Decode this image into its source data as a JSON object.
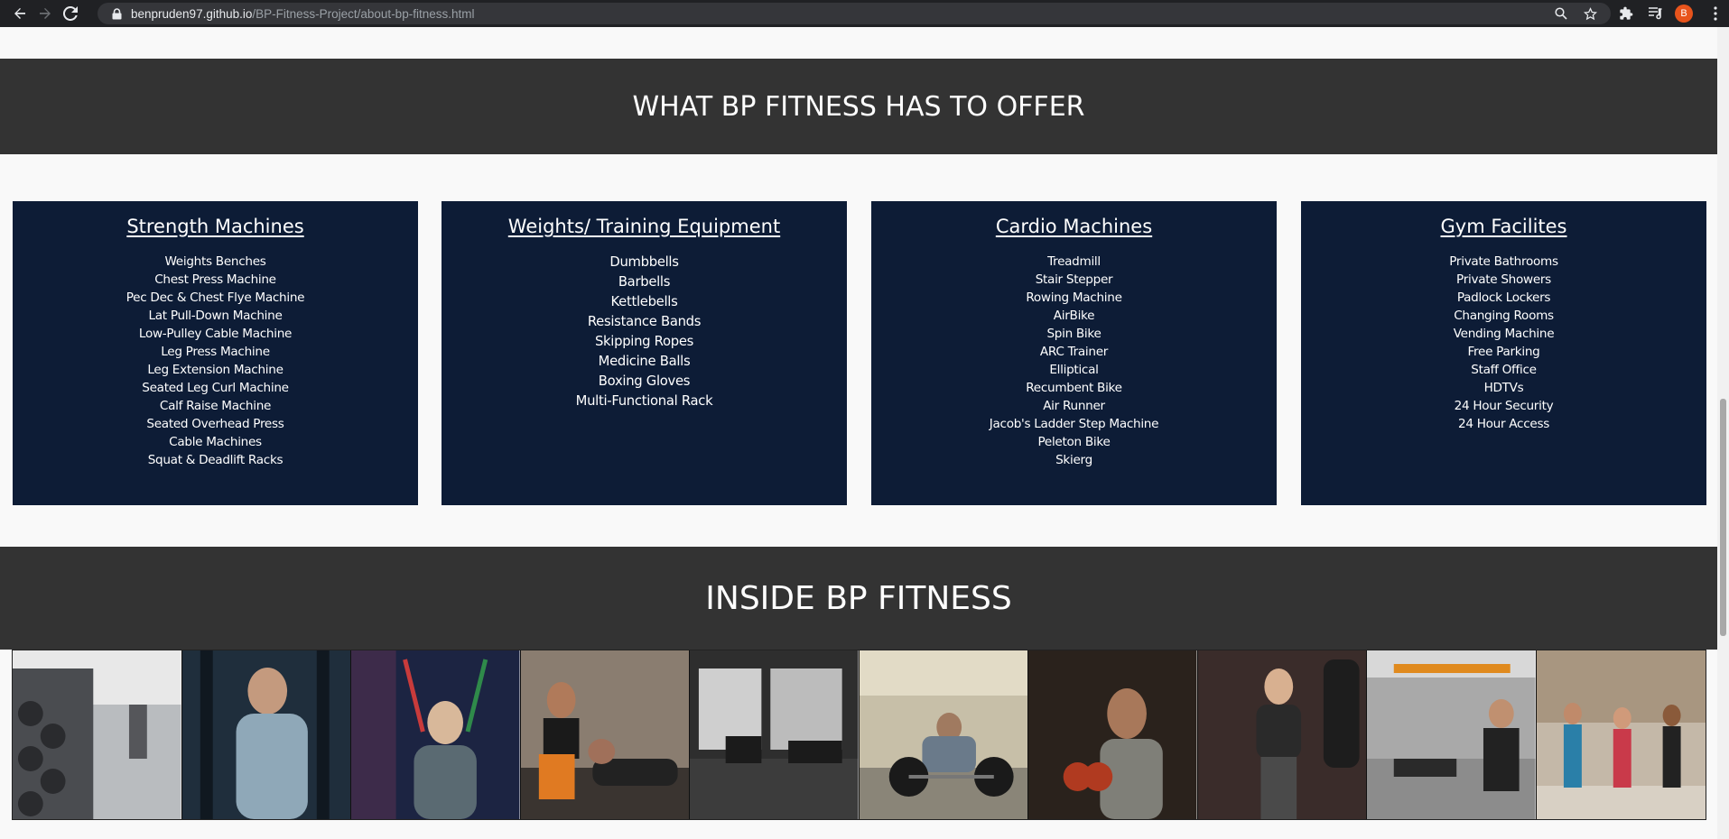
{
  "browser": {
    "url_host": "benpruden97.github.io",
    "url_path": "/BP-Fitness-Project/about-bp-fitness.html",
    "profile_initial": "B"
  },
  "offer_section": {
    "heading": "WHAT BP FITNESS HAS TO OFFER",
    "cards": [
      {
        "title": "Strength Machines",
        "items": [
          "Weights Benches",
          "Chest Press Machine",
          "Pec Dec & Chest Flye Machine",
          "Lat Pull-Down Machine",
          "Low-Pulley Cable Machine",
          "Leg Press Machine",
          "Leg Extension Machine",
          "Seated Leg Curl Machine",
          "Calf Raise Machine",
          "Seated Overhead Press",
          "Cable Machines",
          "Squat & Deadlift Racks"
        ]
      },
      {
        "title": "Weights/ Training Equipment",
        "items": [
          "Dumbbells",
          "Barbells",
          "Kettlebells",
          "Resistance Bands",
          "Skipping Ropes",
          "Medicine Balls",
          "Boxing Gloves",
          "Multi-Functional Rack"
        ]
      },
      {
        "title": "Cardio Machines",
        "items": [
          "Treadmill",
          "Stair Stepper",
          "Rowing Machine",
          "AirBike",
          "Spin Bike",
          "ARC Trainer",
          "Elliptical",
          "Recumbent Bike",
          "Air Runner",
          "Jacob's Ladder Step Machine",
          "Peleton Bike",
          "Skierg"
        ]
      },
      {
        "title": "Gym Facilites",
        "items": [
          "Private Bathrooms",
          "Private Showers",
          "Padlock Lockers",
          "Changing Rooms",
          "Vending Machine",
          "Free Parking",
          "Staff Office",
          "HDTVs",
          "24 Hour Security",
          "24 Hour Access"
        ]
      }
    ]
  },
  "inside_section": {
    "heading": "INSIDE BP FITNESS",
    "photo_count": 10
  },
  "colors": {
    "band_bg": "#333333",
    "card_bg": "#0d1c36",
    "page_bg": "#f9f9f9"
  }
}
